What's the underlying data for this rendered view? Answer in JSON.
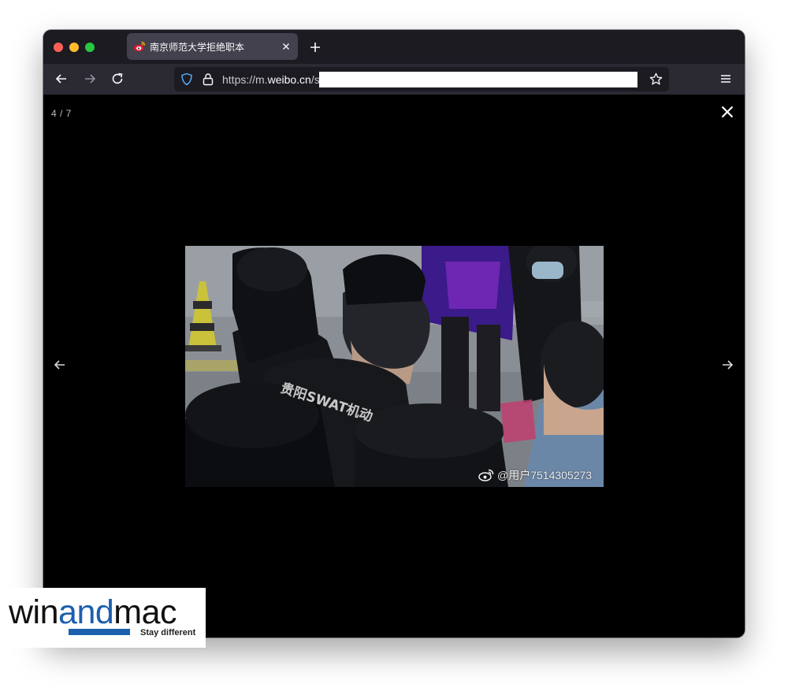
{
  "browser": {
    "tab": {
      "title": "南京师范大学拒绝职本"
    },
    "url": {
      "prefix": "https://m.",
      "domain": "weibo.cn",
      "suffix": "/s"
    }
  },
  "viewer": {
    "counter": "4 / 7",
    "watermark": "@用户7514305273",
    "vest_text": "贵阳SWAT机动"
  },
  "branding": {
    "name_left": "win",
    "name_mid": "and",
    "name_right": "mac",
    "tagline": "Stay different"
  },
  "colors": {
    "tabbar": "#1c1b22",
    "toolbar": "#2b2a33",
    "active_tab": "#42414d",
    "brand_blue": "#1c5fae"
  },
  "icons": [
    "weibo-favicon-icon",
    "close-icon",
    "plus-icon",
    "arrow-left-icon",
    "arrow-right-icon",
    "reload-icon",
    "shield-icon",
    "lock-icon",
    "star-icon",
    "hamburger-menu-icon"
  ]
}
